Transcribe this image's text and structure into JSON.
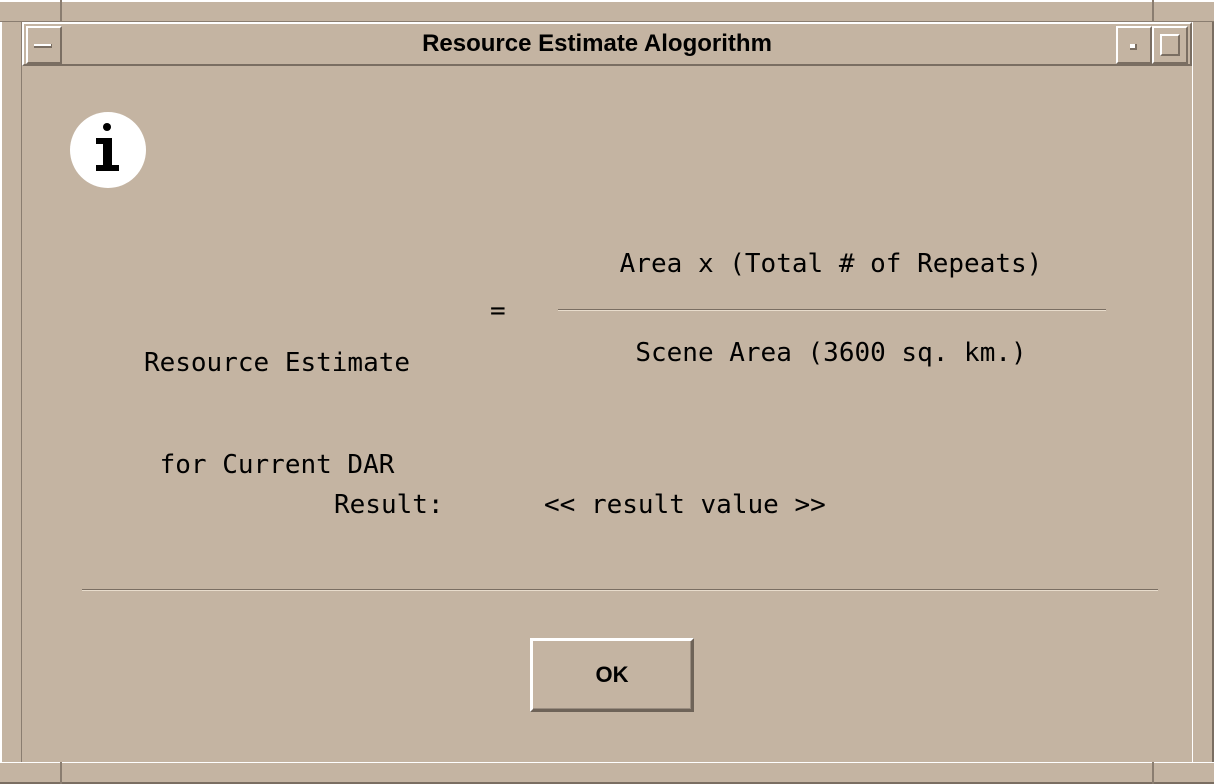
{
  "window": {
    "title": "Resource Estimate Alogorithm"
  },
  "dialog": {
    "icon": "info-icon",
    "lhs_line1": "Resource Estimate",
    "lhs_line2": "for Current DAR",
    "equals": "=",
    "numerator": "Area x (Total # of Repeats)",
    "denominator": "Scene Area (3600 sq. km.)",
    "result_label": "Result:",
    "result_value": "<< result value >>",
    "ok_label": "OK"
  },
  "colors": {
    "background": "#c4b4a2",
    "highlight": "#ffffff",
    "shadow": "#7a6e62",
    "text": "#000000"
  }
}
